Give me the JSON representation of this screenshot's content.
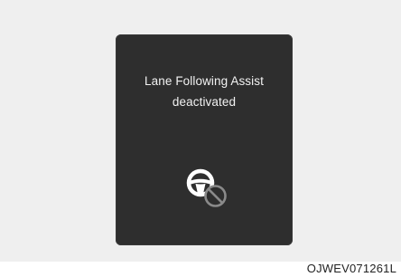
{
  "display": {
    "message_line1": "Lane Following Assist",
    "message_line2": "deactivated",
    "icon": "steering-wheel-prohibited-icon"
  },
  "footer": {
    "code": "OJWEV071261L"
  },
  "colors": {
    "panel": "#2e2e2e",
    "background": "#efefef",
    "text": "#f2f2f2",
    "icon_white": "#ffffff",
    "icon_gray": "#8a8a8a"
  }
}
